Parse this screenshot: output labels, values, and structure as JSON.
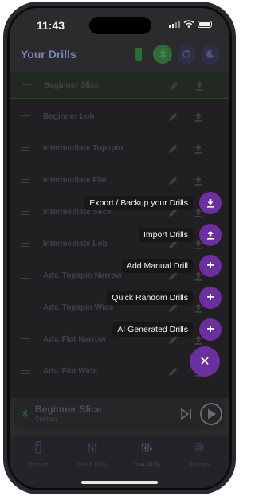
{
  "status": {
    "time": "11:43"
  },
  "header": {
    "title": "Your Drills"
  },
  "drills": [
    {
      "label": "Beginner Slice",
      "selected": true
    },
    {
      "label": "Beginner Lob",
      "selected": false
    },
    {
      "label": "Intermediate Topspin",
      "selected": false
    },
    {
      "label": "Intermediate Flat",
      "selected": false
    },
    {
      "label": "Intermediate Slice",
      "selected": false
    },
    {
      "label": "Intermediate Lob",
      "selected": false
    },
    {
      "label": "Adv. Topspin Narrow",
      "selected": false
    },
    {
      "label": "Adv. Topspin Wide",
      "selected": false
    },
    {
      "label": "Adv. Flat Narrow",
      "selected": false
    },
    {
      "label": "Adv. Flat Wide",
      "selected": false
    }
  ],
  "fab_menu": [
    {
      "label": "Export / Backup your Drills",
      "icon": "export-icon"
    },
    {
      "label": "Import Drills",
      "icon": "import-icon"
    },
    {
      "label": "Add Manual Drill",
      "icon": "plus-icon"
    },
    {
      "label": "Quick Random Drills",
      "icon": "plus-icon"
    },
    {
      "label": "AI Generated Drills",
      "icon": "plus-icon"
    }
  ],
  "fab_close": {
    "glyph": "✕"
  },
  "player": {
    "title": "Beginner Slice",
    "subtitle": "Custom"
  },
  "tabs": [
    {
      "label": "Remote",
      "active": false
    },
    {
      "label": "Quick Drills",
      "active": false
    },
    {
      "label": "Your Drills",
      "active": true
    },
    {
      "label": "Settings",
      "active": false
    }
  ],
  "colors": {
    "accent": "#6b2fa0",
    "selected_border": "#3f6a3a",
    "bluetooth_on": "#2f6b36"
  }
}
